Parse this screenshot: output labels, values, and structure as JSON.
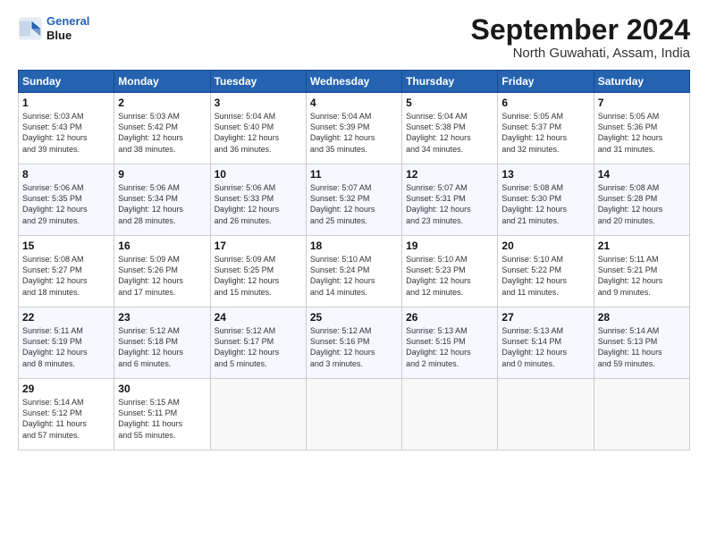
{
  "logo": {
    "line1": "General",
    "line2": "Blue"
  },
  "title": "September 2024",
  "subtitle": "North Guwahati, Assam, India",
  "days_of_week": [
    "Sunday",
    "Monday",
    "Tuesday",
    "Wednesday",
    "Thursday",
    "Friday",
    "Saturday"
  ],
  "weeks": [
    [
      {
        "day": "1",
        "text": "Sunrise: 5:03 AM\nSunset: 5:43 PM\nDaylight: 12 hours\nand 39 minutes."
      },
      {
        "day": "2",
        "text": "Sunrise: 5:03 AM\nSunset: 5:42 PM\nDaylight: 12 hours\nand 38 minutes."
      },
      {
        "day": "3",
        "text": "Sunrise: 5:04 AM\nSunset: 5:40 PM\nDaylight: 12 hours\nand 36 minutes."
      },
      {
        "day": "4",
        "text": "Sunrise: 5:04 AM\nSunset: 5:39 PM\nDaylight: 12 hours\nand 35 minutes."
      },
      {
        "day": "5",
        "text": "Sunrise: 5:04 AM\nSunset: 5:38 PM\nDaylight: 12 hours\nand 34 minutes."
      },
      {
        "day": "6",
        "text": "Sunrise: 5:05 AM\nSunset: 5:37 PM\nDaylight: 12 hours\nand 32 minutes."
      },
      {
        "day": "7",
        "text": "Sunrise: 5:05 AM\nSunset: 5:36 PM\nDaylight: 12 hours\nand 31 minutes."
      }
    ],
    [
      {
        "day": "8",
        "text": "Sunrise: 5:06 AM\nSunset: 5:35 PM\nDaylight: 12 hours\nand 29 minutes."
      },
      {
        "day": "9",
        "text": "Sunrise: 5:06 AM\nSunset: 5:34 PM\nDaylight: 12 hours\nand 28 minutes."
      },
      {
        "day": "10",
        "text": "Sunrise: 5:06 AM\nSunset: 5:33 PM\nDaylight: 12 hours\nand 26 minutes."
      },
      {
        "day": "11",
        "text": "Sunrise: 5:07 AM\nSunset: 5:32 PM\nDaylight: 12 hours\nand 25 minutes."
      },
      {
        "day": "12",
        "text": "Sunrise: 5:07 AM\nSunset: 5:31 PM\nDaylight: 12 hours\nand 23 minutes."
      },
      {
        "day": "13",
        "text": "Sunrise: 5:08 AM\nSunset: 5:30 PM\nDaylight: 12 hours\nand 21 minutes."
      },
      {
        "day": "14",
        "text": "Sunrise: 5:08 AM\nSunset: 5:28 PM\nDaylight: 12 hours\nand 20 minutes."
      }
    ],
    [
      {
        "day": "15",
        "text": "Sunrise: 5:08 AM\nSunset: 5:27 PM\nDaylight: 12 hours\nand 18 minutes."
      },
      {
        "day": "16",
        "text": "Sunrise: 5:09 AM\nSunset: 5:26 PM\nDaylight: 12 hours\nand 17 minutes."
      },
      {
        "day": "17",
        "text": "Sunrise: 5:09 AM\nSunset: 5:25 PM\nDaylight: 12 hours\nand 15 minutes."
      },
      {
        "day": "18",
        "text": "Sunrise: 5:10 AM\nSunset: 5:24 PM\nDaylight: 12 hours\nand 14 minutes."
      },
      {
        "day": "19",
        "text": "Sunrise: 5:10 AM\nSunset: 5:23 PM\nDaylight: 12 hours\nand 12 minutes."
      },
      {
        "day": "20",
        "text": "Sunrise: 5:10 AM\nSunset: 5:22 PM\nDaylight: 12 hours\nand 11 minutes."
      },
      {
        "day": "21",
        "text": "Sunrise: 5:11 AM\nSunset: 5:21 PM\nDaylight: 12 hours\nand 9 minutes."
      }
    ],
    [
      {
        "day": "22",
        "text": "Sunrise: 5:11 AM\nSunset: 5:19 PM\nDaylight: 12 hours\nand 8 minutes."
      },
      {
        "day": "23",
        "text": "Sunrise: 5:12 AM\nSunset: 5:18 PM\nDaylight: 12 hours\nand 6 minutes."
      },
      {
        "day": "24",
        "text": "Sunrise: 5:12 AM\nSunset: 5:17 PM\nDaylight: 12 hours\nand 5 minutes."
      },
      {
        "day": "25",
        "text": "Sunrise: 5:12 AM\nSunset: 5:16 PM\nDaylight: 12 hours\nand 3 minutes."
      },
      {
        "day": "26",
        "text": "Sunrise: 5:13 AM\nSunset: 5:15 PM\nDaylight: 12 hours\nand 2 minutes."
      },
      {
        "day": "27",
        "text": "Sunrise: 5:13 AM\nSunset: 5:14 PM\nDaylight: 12 hours\nand 0 minutes."
      },
      {
        "day": "28",
        "text": "Sunrise: 5:14 AM\nSunset: 5:13 PM\nDaylight: 11 hours\nand 59 minutes."
      }
    ],
    [
      {
        "day": "29",
        "text": "Sunrise: 5:14 AM\nSunset: 5:12 PM\nDaylight: 11 hours\nand 57 minutes."
      },
      {
        "day": "30",
        "text": "Sunrise: 5:15 AM\nSunset: 5:11 PM\nDaylight: 11 hours\nand 55 minutes."
      },
      {
        "day": "",
        "text": ""
      },
      {
        "day": "",
        "text": ""
      },
      {
        "day": "",
        "text": ""
      },
      {
        "day": "",
        "text": ""
      },
      {
        "day": "",
        "text": ""
      }
    ]
  ]
}
